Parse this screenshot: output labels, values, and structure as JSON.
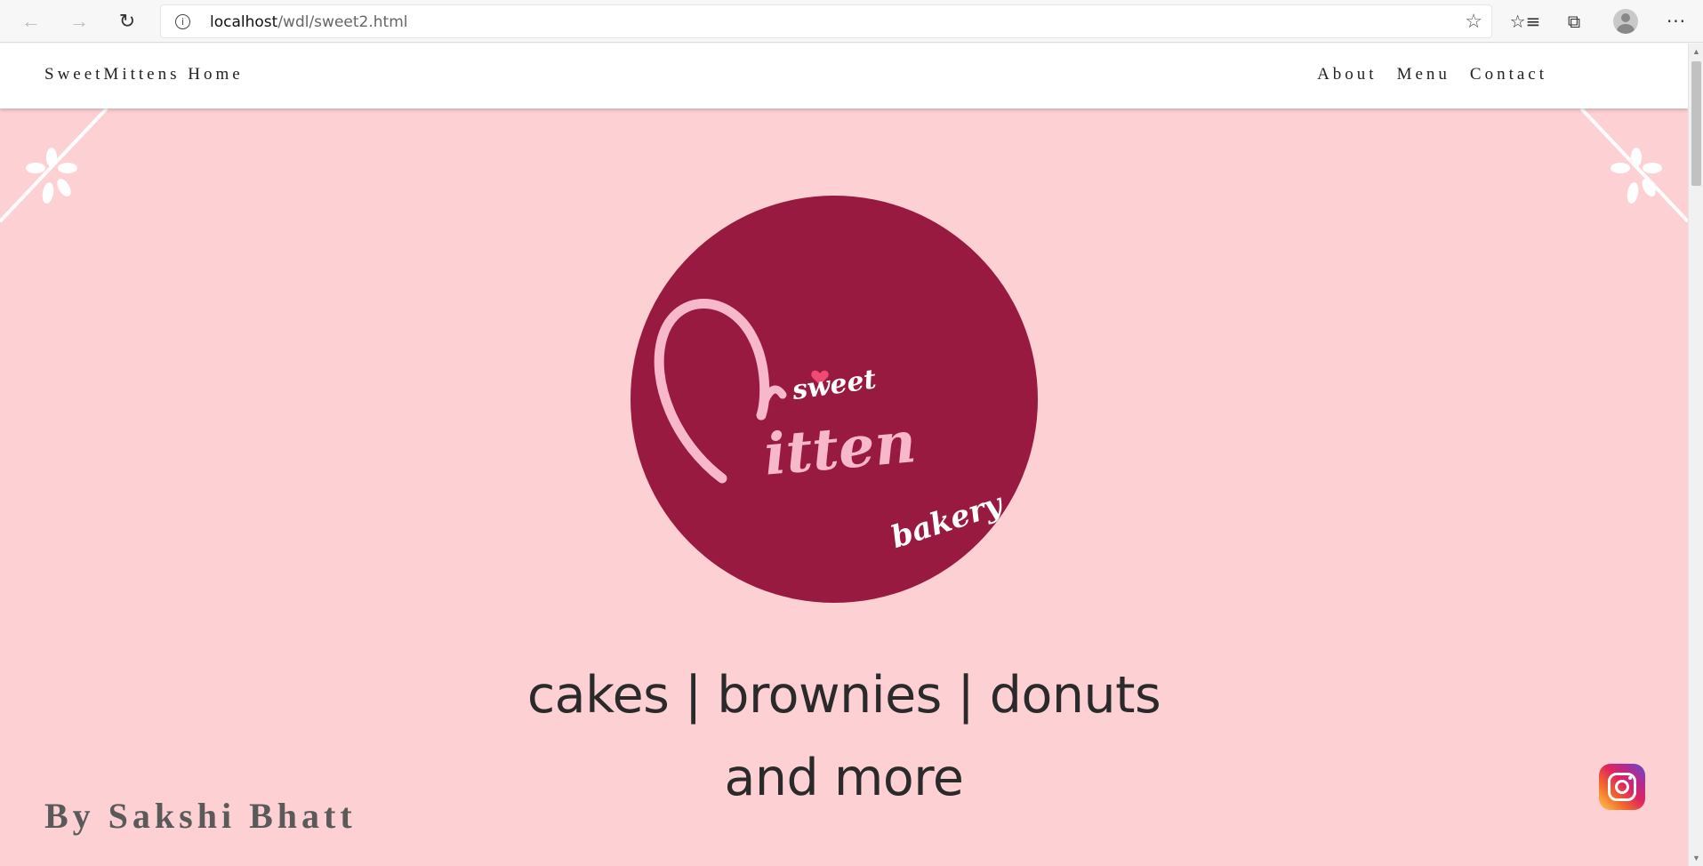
{
  "browser": {
    "url_host": "localhost",
    "url_path": "/wdl/sweet2.html",
    "icons": {
      "back": "back-arrow-icon",
      "forward": "forward-arrow-icon",
      "refresh": "refresh-icon",
      "info": "info-icon",
      "favorite": "star-icon",
      "favorites": "favorites-icon",
      "collections": "collections-icon",
      "profile": "profile-icon",
      "more": "more-icon"
    }
  },
  "site": {
    "brand": "SweetMittens Home",
    "menu": [
      "About",
      "Menu",
      "Contact"
    ],
    "logo_text": {
      "sweet": "sweet",
      "mitten": "itten",
      "bakery": "bakery"
    },
    "tagline_line1": "cakes | brownies | donuts",
    "tagline_line2": "and more",
    "author": "By Sakshi Bhatt",
    "social_icon": "instagram-icon"
  },
  "colors": {
    "hero_background": "#fdd1d3",
    "logo_circle": "#981a40",
    "logo_script": "#f7b8cc",
    "logo_heart": "#ef4b72",
    "nav_background": "#ffffff"
  }
}
